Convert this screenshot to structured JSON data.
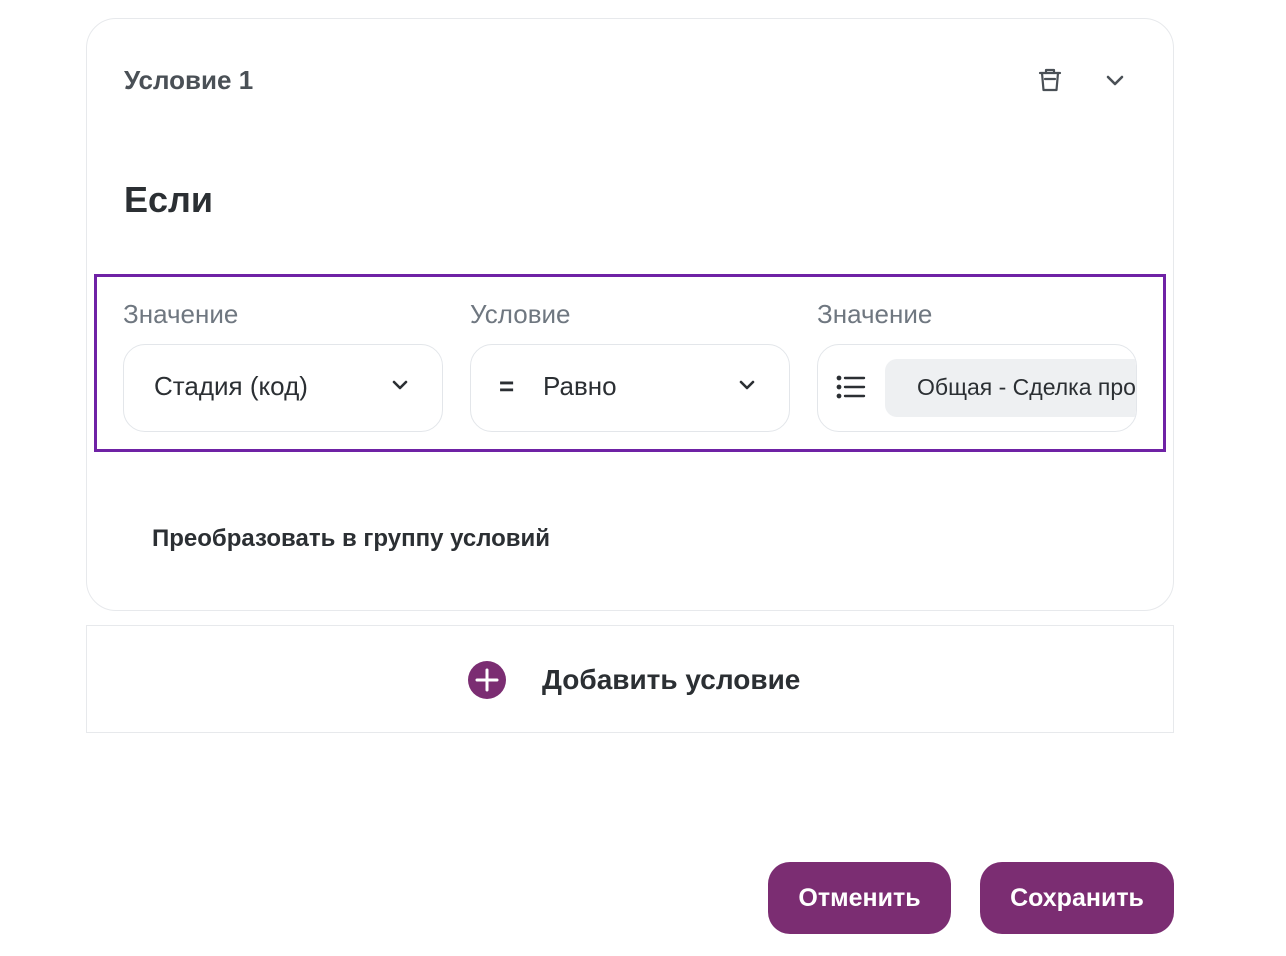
{
  "condition_card": {
    "title": "Условие 1",
    "if_label": "Если",
    "fields": {
      "left_value": {
        "label": "Значение",
        "selected": "Стадия (код)"
      },
      "operator": {
        "label": "Условие",
        "symbol": "=",
        "selected": "Равно"
      },
      "right_value": {
        "label": "Значение",
        "chip": "Общая - Сделка проиграна"
      }
    },
    "convert_link": "Преобразовать в группу условий"
  },
  "add_condition": {
    "label": "Добавить условие"
  },
  "actions": {
    "cancel_label": "Отменить",
    "save_label": "Сохранить"
  },
  "icons": {
    "trash": "trash-icon",
    "collapse": "chevron-down-icon",
    "list": "list-icon",
    "add": "plus-circle-icon"
  },
  "colors": {
    "accent": "#7b2d72",
    "highlight_border": "#6f22a5",
    "label_gray": "#6f7780",
    "chip_bg": "#eef0f2"
  }
}
